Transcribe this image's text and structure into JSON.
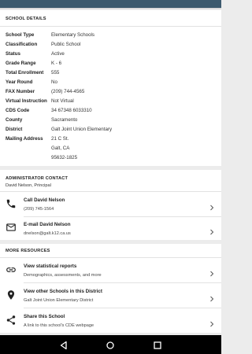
{
  "school_details": {
    "title": "SCHOOL DETAILS",
    "rows": [
      {
        "label": "School Type",
        "value": "Elementary Schools"
      },
      {
        "label": "Classification",
        "value": "Public School"
      },
      {
        "label": "Status",
        "value": "Active"
      },
      {
        "label": "Grade Range",
        "value": "K - 6"
      },
      {
        "label": "Total Enrollment",
        "value": "555"
      },
      {
        "label": "Year Round",
        "value": "No"
      },
      {
        "label": "FAX Number",
        "value": "(209) 744-4565"
      },
      {
        "label": "Virtual Instruction",
        "value": "Not Virtual"
      },
      {
        "label": "CDS Code",
        "value": "34 67348 6033310"
      },
      {
        "label": "County",
        "value": "Sacramento"
      },
      {
        "label": "District",
        "value": "Galt Joint Union Elementary"
      }
    ],
    "mailing": {
      "label": "Mailing Address",
      "lines": [
        "21 C St.",
        "Galt, CA",
        "95632-1825"
      ]
    }
  },
  "admin": {
    "title": "ADMINISTRATOR CONTACT",
    "subtitle": "David Nelson, Principal",
    "call": {
      "title": "Call David Nelson",
      "subtitle": "(209) 745-1564",
      "icon": "phone-icon"
    },
    "email": {
      "title": "E-mail David Nelson",
      "subtitle": "dnelson@galt.k12.ca.us",
      "icon": "email-icon"
    }
  },
  "resources": {
    "title": "MORE RESOURCES",
    "items": [
      {
        "title": "View statistical reports",
        "subtitle": "Demographics, assessments, and more",
        "icon": "link-icon"
      },
      {
        "title": "View other Schools in this District",
        "subtitle": "Galt Joint Union Elementary District",
        "icon": "location-pin-icon"
      },
      {
        "title": "Share this School",
        "subtitle": "A link to this school's CDE webpage",
        "icon": "share-icon"
      }
    ]
  },
  "colors": {
    "status_bar": "#3c5a6e",
    "nav_bar": "#000000",
    "icon": "#222222"
  }
}
